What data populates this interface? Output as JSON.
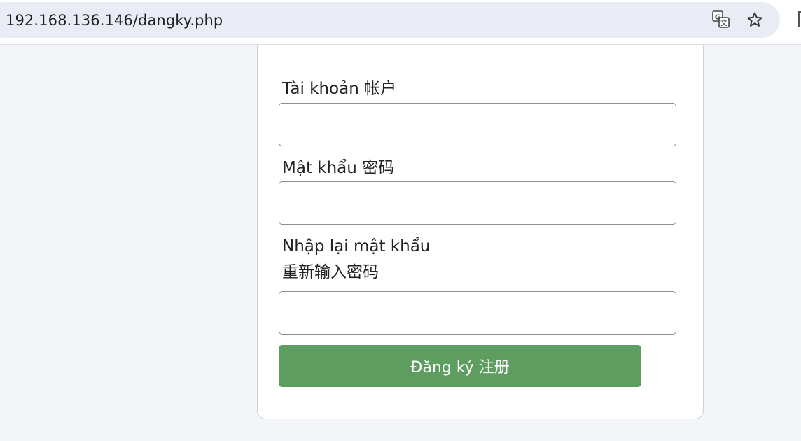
{
  "browser": {
    "url": "192.168.136.146/dangky.php",
    "site_info_glyph": "⇋",
    "icons": [
      "translate-icon",
      "bookmark-star-icon",
      "site-info-icon"
    ]
  },
  "form": {
    "username": {
      "label": "Tài khoản 帐户",
      "value": "",
      "placeholder": ""
    },
    "password": {
      "label": "Mật khẩu 密码",
      "value": "",
      "placeholder": ""
    },
    "confirm_password": {
      "label_line1": "Nhập lại mật khẩu",
      "label_line2": "重新输入密码",
      "value": "",
      "placeholder": ""
    },
    "submit_label": "Đăng ký 注册"
  },
  "colors": {
    "page_background": "#f4f5f9",
    "button": "#5d9e60",
    "button_text": "#ffffff",
    "card_border": "#c8d3de"
  }
}
